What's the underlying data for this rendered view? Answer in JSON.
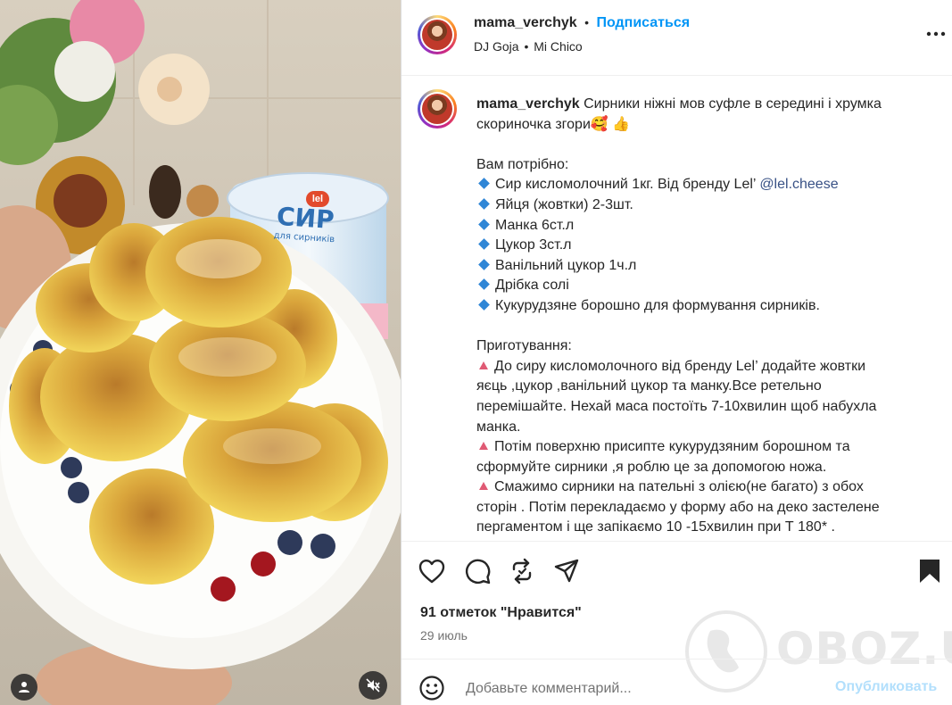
{
  "post": {
    "author": {
      "username": "mama_verchyk",
      "follow_label": "Подписаться",
      "dot": "•"
    },
    "audio": {
      "artist": "DJ Goja",
      "separator": "•",
      "track": "Mi Chico"
    },
    "more_icon": "more-horizontal-icon",
    "caption": {
      "username": "mama_verchyk",
      "lines": [
        "Сирники ніжні мов суфле в середині і хрумка",
        "скориночка згори🥰 👍"
      ],
      "needs_title": "Вам потрібно:",
      "ingredients": [
        {
          "text": "Сир кисломолочний 1кг. Від бренду Lel’ ",
          "mention": "@lel.cheese"
        },
        {
          "text": "Яйця (жовтки) 2-3шт.",
          "mention": ""
        },
        {
          "text": "Манка 6ст.л",
          "mention": ""
        },
        {
          "text": "Цукор 3ст.л",
          "mention": ""
        },
        {
          "text": "Ванільний цукор 1ч.л",
          "mention": ""
        },
        {
          "text": "Дрібка солі",
          "mention": ""
        },
        {
          "text": "Кукурудзяне борошно для формування сирників.",
          "mention": ""
        }
      ],
      "prep_title": "Приготування:",
      "steps": [
        [
          "До сиру кисломолочного від бренду Lel’ додайте жовтки",
          "яєць ,цукор ,ванільний цукор та манку.Все ретельно",
          "перемішайте. Нехай маса постоїть 7-10хвилин щоб набухла",
          "манка."
        ],
        [
          "Потім поверхню присипте кукурудзяним борошном та",
          "сформуйте сирники ,я роблю це за допомогою ножа."
        ],
        [
          "Смажимо сирники на пательні з олією(не багато) з обох",
          "сторін . Потім перекладаємо у форму або на деко застелене",
          "пергаментом і ще запікаємо 10 -15хвилин при Т 180* ."
        ]
      ]
    },
    "actions": {
      "like_icon": "heart-icon",
      "comment_icon": "comment-icon",
      "repost_icon": "repost-icon",
      "share_icon": "share-icon",
      "save_icon": "bookmark-icon"
    },
    "likes": "91 отметок \"Нравится\"",
    "date": "29 июль",
    "comment": {
      "emoji_icon": "emoji-icon",
      "placeholder": "Добавьте комментарий...",
      "post_label": "Опубликовать"
    },
    "watermark": "OBOZ.UA",
    "media": {
      "product_label": "СИР",
      "product_sub": "для сирників",
      "brand": "lel",
      "user_icon": "user-icon",
      "mute_icon": "muted-speaker-icon"
    }
  }
}
